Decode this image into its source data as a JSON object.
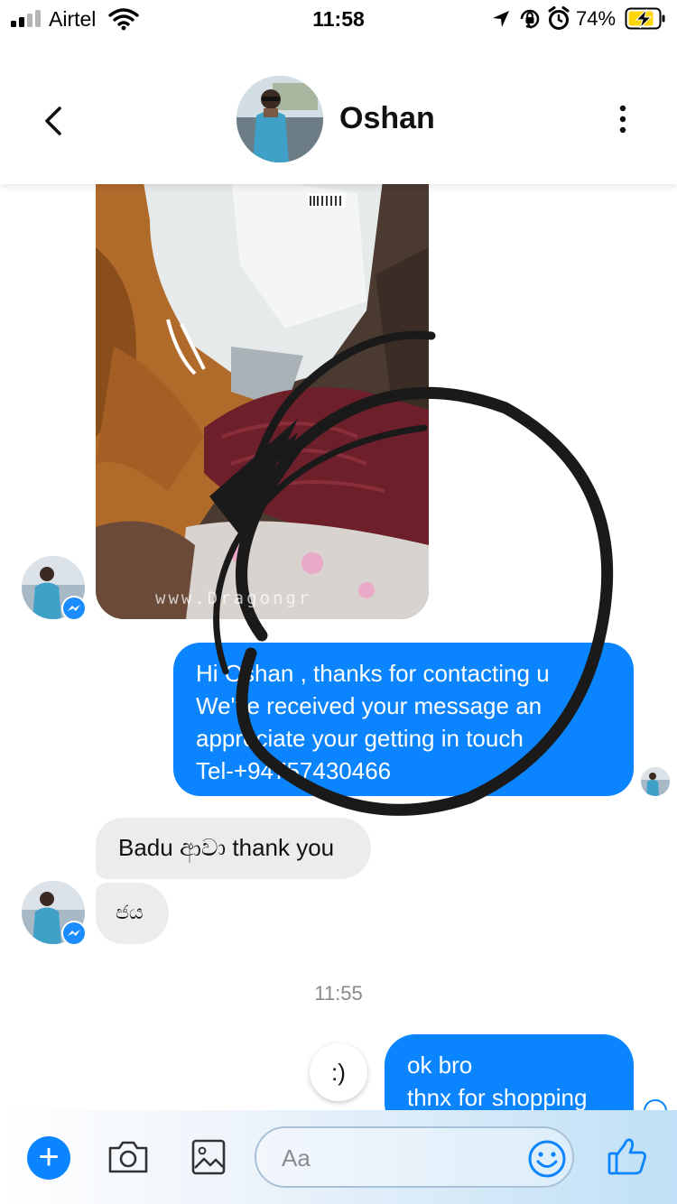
{
  "status_bar": {
    "carrier": "Airtel",
    "time": "11:58",
    "battery_percent": "74%",
    "icons": [
      "signal-icon",
      "wifi-icon",
      "location-icon",
      "orientation-lock-icon",
      "alarm-icon",
      "battery-charging-icon"
    ]
  },
  "header": {
    "contact_name": "Oshan",
    "back_icon": "chevron-left-icon",
    "menu_icon": "vertical-dots-icon"
  },
  "messages": {
    "photo_watermark": "www.Dragongr",
    "outgoing_1": {
      "lines": [
        "Hi Oshan , thanks for contacting u",
        "We've received your message an",
        "appreciate your getting in touch",
        "Tel-+94757430466"
      ]
    },
    "incoming_1": "Badu ආවා thank you",
    "incoming_2": "ජය",
    "timestamp": "11:55",
    "reaction": ":)",
    "outgoing_2": {
      "lines": [
        "ok bro",
        "thnx for shopping"
      ]
    }
  },
  "composer": {
    "placeholder": "Aa",
    "icons": [
      "plus-icon",
      "camera-icon",
      "gallery-icon",
      "emoji-icon",
      "thumbs-up-icon"
    ]
  },
  "colors": {
    "accent": "#0a84ff",
    "incoming_bubble": "#ececee",
    "timestamp": "#8a8a8e"
  }
}
